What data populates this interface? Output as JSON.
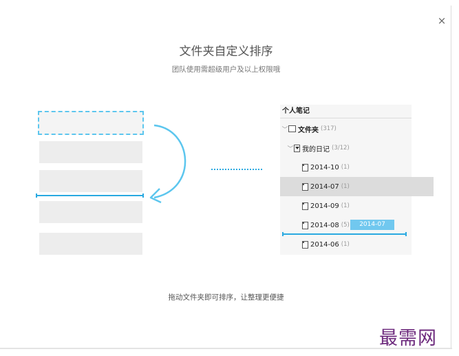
{
  "dialog": {
    "close_label": "×",
    "title": "文件夹自定义排序",
    "subtitle": "团队使用需超级用户及以上权限哦",
    "footer": "拖动文件夹即可排序，让整理更便捷"
  },
  "panel": {
    "header": "个人笔记",
    "items": [
      {
        "label": "文件夹",
        "count": "(317)",
        "icon": "notebook-icon",
        "expand": "chevron-down-icon",
        "selected": false
      },
      {
        "label": "我的日记",
        "count": "(3/12)",
        "icon": "stack-icon",
        "expand": "chevron-down-icon",
        "selected": false
      },
      {
        "label": "2014-10",
        "count": "(1)",
        "icon": "notebook-icon",
        "selected": false
      },
      {
        "label": "2014-07",
        "count": "(1)",
        "icon": "notebook-icon",
        "selected": true
      },
      {
        "label": "2014-09",
        "count": "(1)",
        "icon": "notebook-icon",
        "selected": false
      },
      {
        "label": "2014-08",
        "count": "(5)",
        "icon": "notebook-icon",
        "selected": false
      },
      {
        "label": "2014-06",
        "count": "(1)",
        "icon": "notebook-icon",
        "selected": false
      }
    ],
    "drag_tag": "2014-07"
  },
  "watermark": "最需网",
  "colors": {
    "accent": "#29a9e1",
    "watermark": "#6d2a7d",
    "bar": "#ededed",
    "selected_row": "#dcdcdc"
  }
}
